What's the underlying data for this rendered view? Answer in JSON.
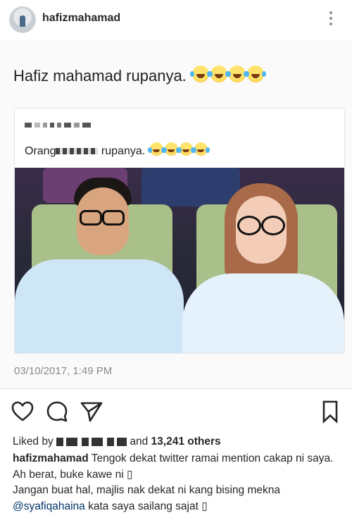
{
  "header": {
    "username": "hafizmahamad",
    "more_icon": "more-vertical-icon"
  },
  "post": {
    "caption": "Hafiz mahamad rupanya.",
    "caption_emojis": [
      "face-with-tears-of-joy",
      "face-with-tears-of-joy",
      "face-with-tears-of-joy",
      "face-with-tears-of-joy"
    ],
    "card": {
      "author_redacted": true,
      "text_start": "Orang",
      "text_end": "rupanya.",
      "emojis": [
        "face-with-tears-of-joy",
        "face-with-tears-of-joy",
        "face-with-tears-of-joy",
        "face-with-tears-of-joy"
      ],
      "timestamp": "03/10/2017, 1:49 PM"
    }
  },
  "actions": {
    "like_icon": "heart-icon",
    "comment_icon": "comment-icon",
    "share_icon": "share-icon",
    "save_icon": "bookmark-icon"
  },
  "likes": {
    "prefix": "Liked by",
    "connector": "and",
    "count": "13,241 others"
  },
  "caption": {
    "username": "hafizmahamad",
    "line1": "Tengok dekat twitter ramai mention cakap ni saya. Ah berat, buke kawe ni",
    "line2": "Jangan buat hal, majlis nak dekat ni kang bising mekna",
    "mention": "@syafiqahaina",
    "line3": "kata saya sailang sajat",
    "glyph": "▯"
  },
  "colors": {
    "background": "#ffffff",
    "post_background": "#fafafa",
    "text": "#262626",
    "muted": "#8a8a8a",
    "mention": "#003569"
  }
}
